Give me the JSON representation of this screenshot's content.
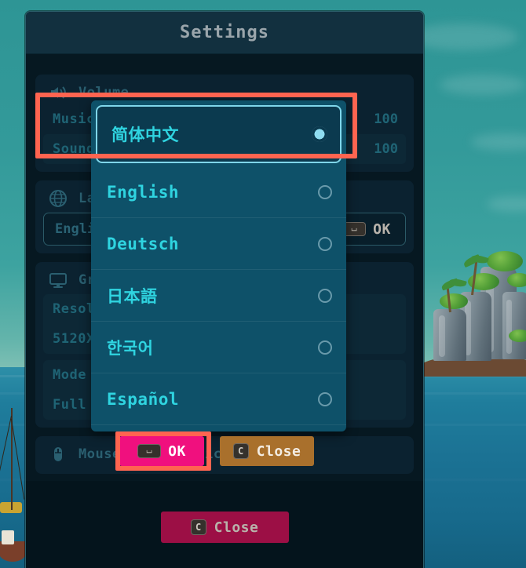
{
  "window": {
    "title": "Settings"
  },
  "sections": {
    "volume": {
      "title": "Volume",
      "icon": "speaker-icon",
      "rows": [
        {
          "label": "Music",
          "value": "100"
        },
        {
          "label": "Sound",
          "value": "100"
        }
      ]
    },
    "language": {
      "title": "Language",
      "icon": "globe-icon",
      "selected": "English",
      "confirm_label": "OK",
      "confirm_key": "⌴"
    },
    "graphics": {
      "title": "Graphics",
      "icon": "monitor-icon",
      "rows": [
        {
          "label": "Resolution",
          "value": "5120X1440"
        },
        {
          "label": "Mode",
          "value": "Full Window Mode"
        }
      ]
    },
    "mouse": {
      "title": "Mouse Input Device",
      "icon": "mouse-icon"
    }
  },
  "dropdown": {
    "options": [
      {
        "label": "简体中文",
        "selected": true
      },
      {
        "label": "English",
        "selected": false
      },
      {
        "label": "Deutsch",
        "selected": false
      },
      {
        "label": "日本語",
        "selected": false
      },
      {
        "label": "한국어",
        "selected": false
      },
      {
        "label": "Español",
        "selected": false
      }
    ]
  },
  "cta": {
    "ok_label": "OK",
    "ok_key": "⌴",
    "close_label": "Close",
    "close_key": "C"
  },
  "footer": {
    "close_label": "Close",
    "close_key": "C"
  },
  "colors": {
    "accent_pink": "#f0107e",
    "accent_brown": "#a9702c",
    "accent_crimson": "#9c0f45",
    "annotation_red": "#ff6450",
    "dropdown_bg": "#0e5169",
    "dropdown_text": "#2fd4e0",
    "panel_bg": "#061821"
  }
}
